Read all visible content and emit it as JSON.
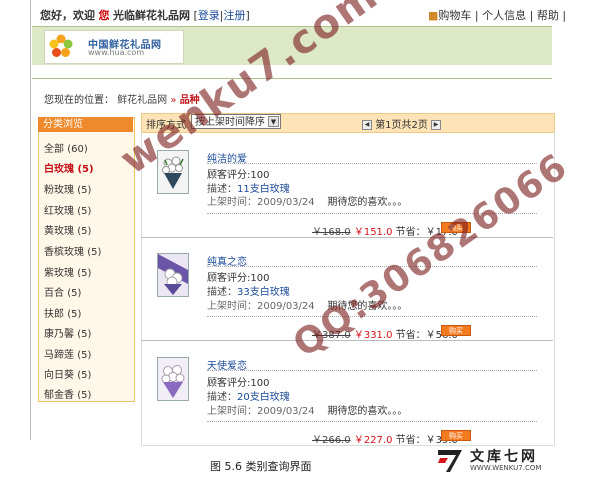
{
  "top": {
    "greet_prefix": "您好，欢迎",
    "greet_icon_text": "您",
    "greet_site": "光临鲜花礼品网",
    "login_label": "登录",
    "register_label": "注册",
    "cart_label": "购物车",
    "profile_label": "个人信息",
    "help_label": "帮助"
  },
  "logo": {
    "cn": "中国鲜花礼品网",
    "en": "www.hua.com"
  },
  "breadcrumb": {
    "prefix": "您现在的位置：",
    "site": "鲜花礼品网",
    "separator": "»",
    "current": "品种"
  },
  "sidebar": {
    "title": "分类浏览",
    "items": [
      {
        "label": "全部",
        "count": "(60)"
      },
      {
        "label": "白玫瑰",
        "count": "(5)"
      },
      {
        "label": "粉玫瑰",
        "count": "(5)"
      },
      {
        "label": "红玫瑰",
        "count": "(5)"
      },
      {
        "label": "黄玫瑰",
        "count": "(5)"
      },
      {
        "label": "香槟玫瑰",
        "count": "(5)"
      },
      {
        "label": "紫玫瑰",
        "count": "(5)"
      },
      {
        "label": "百合",
        "count": "(5)"
      },
      {
        "label": "扶郎",
        "count": "(5)"
      },
      {
        "label": "康乃馨",
        "count": "(5)"
      },
      {
        "label": "马蹄莲",
        "count": "(5)"
      },
      {
        "label": "向日葵",
        "count": "(5)"
      },
      {
        "label": "郁金香",
        "count": "(5)"
      }
    ],
    "active_index": 1
  },
  "sort": {
    "label": "排序方式",
    "selected": "按上架时间降序",
    "pager": "第1页共2页"
  },
  "products": [
    {
      "name": "纯洁的爱",
      "rating": "顾客评分:100",
      "desc_label": "描述：",
      "desc_value": "11支白玫瑰",
      "date": "上架时间：2009/03/24",
      "note": "期待您的喜欢。。。",
      "old_price": "￥168.0",
      "new_price": "￥151.0",
      "save": "节省：￥17.0",
      "buy": "购买"
    },
    {
      "name": "纯真之恋",
      "rating": "顾客评分:100",
      "desc_label": "描述：",
      "desc_value": "33支白玫瑰",
      "date": "上架时间：2009/03/24",
      "note": "期待您的喜欢。。。",
      "old_price": "￥387.0",
      "new_price": "￥331.0",
      "save": "节省：￥56.0",
      "buy": "购买"
    },
    {
      "name": "天使爱恋",
      "rating": "顾客评分:100",
      "desc_label": "描述：",
      "desc_value": "20支白玫瑰",
      "date": "上架时间：2009/03/24",
      "note": "期待您的喜欢。。。",
      "old_price": "￥266.0",
      "new_price": "￥227.0",
      "save": "节省：￥39.0",
      "buy": "购买"
    }
  ],
  "watermark": {
    "line1": "wenku7.com",
    "line2": "QQ:306826066"
  },
  "caption": "图 5.6  类别查询界面",
  "brand": {
    "cn": "文库七网",
    "url": "WWW.WENKU7.COM"
  },
  "colors": {
    "accent_orange": "#ef8a2c",
    "header_green": "#dde9c6",
    "price_red": "#d5141b",
    "link_blue": "#1a4a9a"
  }
}
